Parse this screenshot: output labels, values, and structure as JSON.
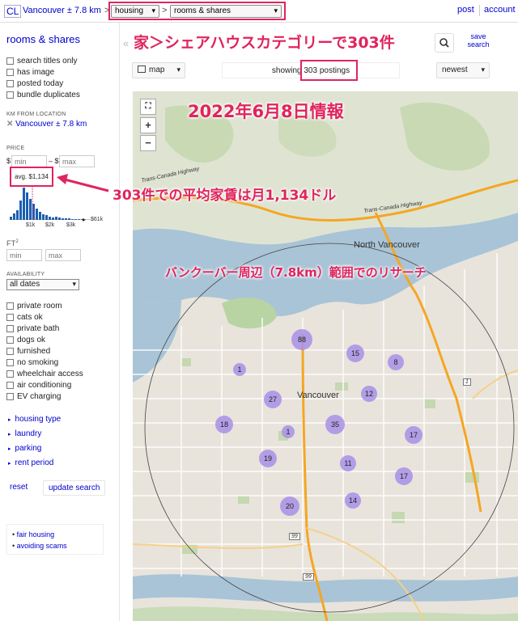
{
  "colors": {
    "accent": "#e0245e",
    "link": "#0000cc",
    "cluster": "#a791e6",
    "water": "#a9c4d7",
    "park": "#c5d8b0"
  },
  "topbar": {
    "logo": "CL",
    "location": "Vancouver ± 7.8 km",
    "gt1": ">",
    "category": "housing",
    "gt2": ">",
    "subcategory": "rooms & shares",
    "post": "post",
    "account": "account"
  },
  "sidebar": {
    "title": "rooms & shares",
    "filters": [
      "search titles only",
      "has image",
      "posted today",
      "bundle duplicates"
    ],
    "km_label": "KM FROM LOCATION",
    "km_value": "Vancouver ± 7.8 km",
    "km_icon": "close-x-icon",
    "price_label": "PRICE",
    "price_dollar1": "$",
    "price_min_placeholder": "min",
    "price_dash": "– $",
    "price_max_placeholder": "max",
    "avg": "avg. $1,134",
    "hist_ticks": [
      "$1k",
      "$2k",
      "$3k",
      "$61k"
    ],
    "ft_label": "FT",
    "ft_sup": "2",
    "ft_min_placeholder": "min",
    "ft_max_placeholder": "max",
    "availability_label": "AVAILABILITY",
    "availability_value": "all dates",
    "options": [
      "private room",
      "cats ok",
      "private bath",
      "dogs ok",
      "furnished",
      "no smoking",
      "wheelchair access",
      "air conditioning",
      "EV charging"
    ],
    "expanders": [
      "housing type",
      "laundry",
      "parking",
      "rent period"
    ],
    "reset": "reset",
    "update": "update search",
    "bottom_links": [
      "fair housing",
      "avoiding scams"
    ]
  },
  "main": {
    "save_search": "save search",
    "view_mode": "map",
    "showing_prefix": "showing",
    "showing_count": "303 postings",
    "sort": "newest"
  },
  "map": {
    "labels": {
      "north_vancouver": "North Vancouver",
      "vancouver": "Vancouver",
      "hwy1": "Trans-Canada Highway",
      "hwy2": "Trans-Canada Highway",
      "hwy_num1": "1",
      "hwy_num2": "99",
      "hwy_num3": "99"
    },
    "clusters": [
      "88",
      "15",
      "8",
      "1",
      "27",
      "12",
      "18",
      "35",
      "1",
      "17",
      "19",
      "11",
      "17",
      "20",
      "14"
    ]
  },
  "annotations": {
    "headline": "家＞シェアハウスカテゴリーで303件",
    "date": "2022年6月8日情報",
    "avg_note": "303件での平均家賃は月1,134ドル",
    "range_note": "バンクーバー周辺（7.8km）範囲でのリサーチ"
  }
}
